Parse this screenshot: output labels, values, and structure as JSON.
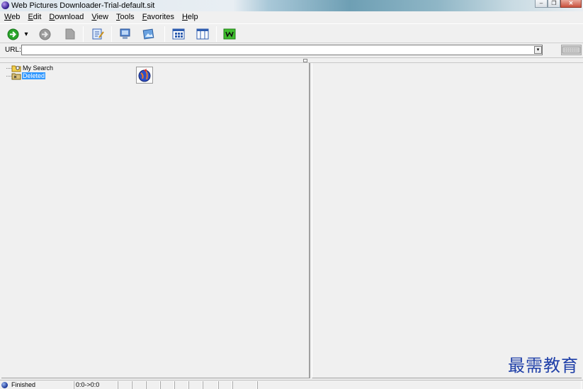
{
  "window": {
    "title": "Web Pictures Downloader-Trial-default.sit",
    "minimize_glyph": "–",
    "restore_glyph": "❐",
    "close_glyph": "✕"
  },
  "menu": [
    {
      "accel": "W",
      "rest": "eb"
    },
    {
      "accel": "E",
      "rest": "dit"
    },
    {
      "accel": "D",
      "rest": "ownload"
    },
    {
      "accel": "V",
      "rest": "iew"
    },
    {
      "accel": "T",
      "rest": "ools"
    },
    {
      "accel": "F",
      "rest": "avorites"
    },
    {
      "accel": "H",
      "rest": "elp"
    }
  ],
  "toolbar": {
    "icons": [
      "go-arrow-icon",
      "dropdown-icon",
      "forward-icon",
      "page-icon",
      "edit-page-icon",
      "computer-icon",
      "picture-icon",
      "grid-view-icon",
      "column-view-icon",
      "shop-icon"
    ],
    "dropdown_glyph": "▾"
  },
  "url": {
    "label": "URL:",
    "value": "",
    "dropdown_glyph": "▾"
  },
  "tree": {
    "items": [
      {
        "label": "My Search",
        "icon": "search-folder-icon",
        "selected": false
      },
      {
        "label": "Deleted",
        "icon": "deleted-folder-icon",
        "selected": true
      }
    ]
  },
  "watermark": "最需教育",
  "status": {
    "text": "Finished",
    "counter": "0:0->0:0"
  },
  "colors": {
    "accent_green": "#2aa52a",
    "selection": "#3399ff",
    "watermark": "#1f3fa8"
  }
}
